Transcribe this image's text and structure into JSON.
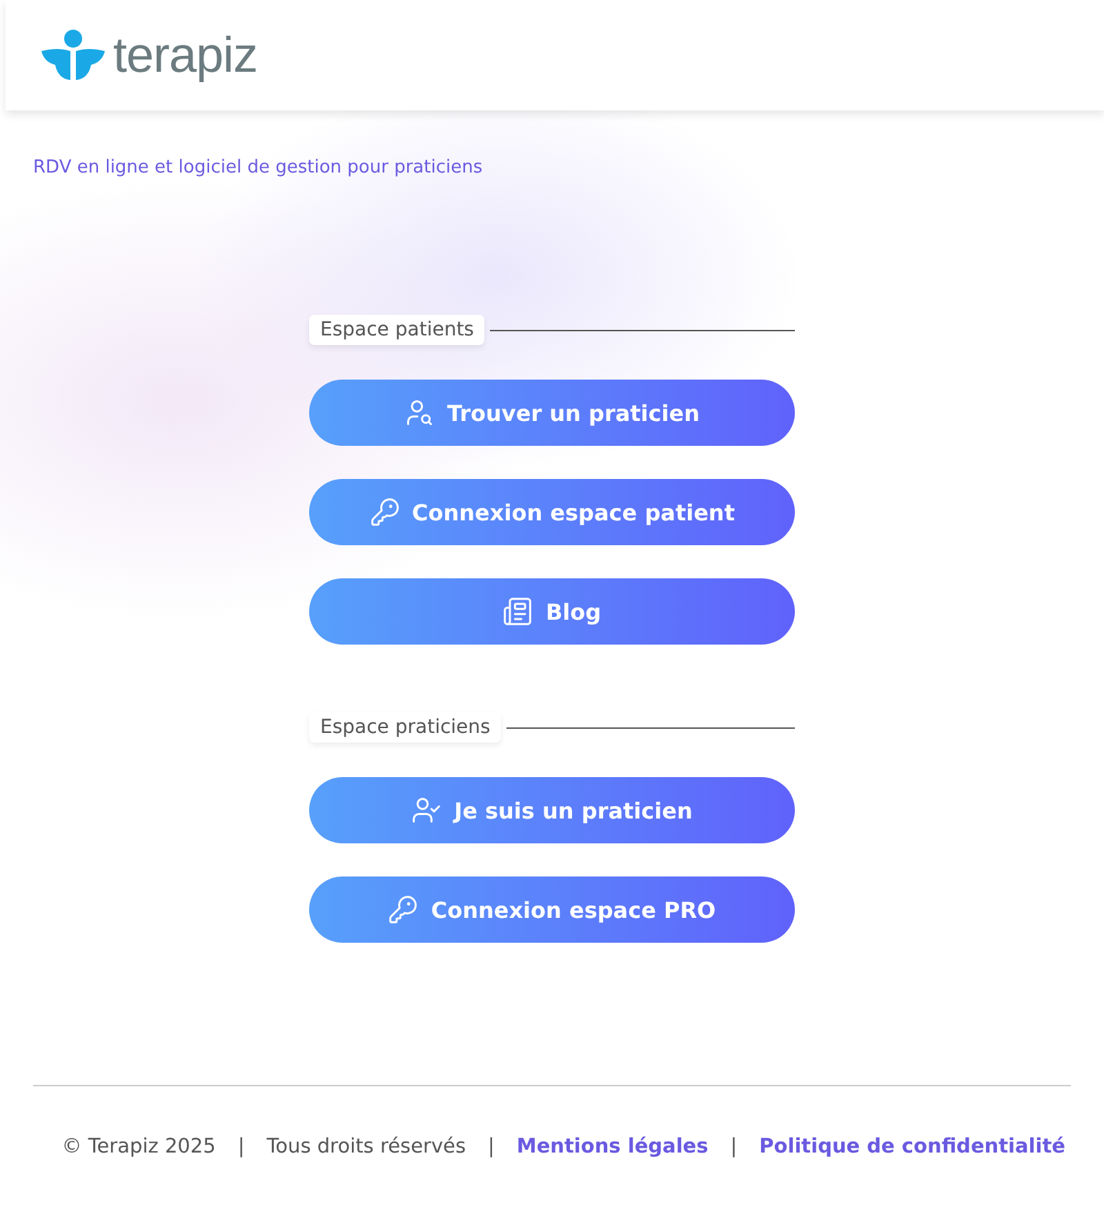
{
  "header": {
    "logo_text": "terapiz"
  },
  "tagline": "RDV en ligne et logiciel de gestion pour praticiens",
  "sections": [
    {
      "title": "Espace patients",
      "buttons": [
        {
          "label": "Trouver un praticien",
          "kind": "search"
        },
        {
          "label": "Connexion espace patient",
          "kind": "login"
        },
        {
          "label": "Blog",
          "kind": "blog"
        }
      ]
    },
    {
      "title": "Espace praticiens",
      "buttons": [
        {
          "label": "Je suis un praticien",
          "kind": "signup"
        },
        {
          "label": "Connexion espace PRO",
          "kind": "login"
        }
      ]
    }
  ],
  "footer": [
    {
      "kind": "text",
      "text": "© Terapiz 2025"
    },
    {
      "kind": "separator",
      "text": "|"
    },
    {
      "kind": "text",
      "text": "Tous droits réservés"
    },
    {
      "kind": "separator",
      "text": "|"
    },
    {
      "kind": "link",
      "text": "Mentions légales"
    },
    {
      "kind": "separator",
      "text": "|"
    },
    {
      "kind": "link",
      "text": "Politique de confidentialité"
    }
  ]
}
